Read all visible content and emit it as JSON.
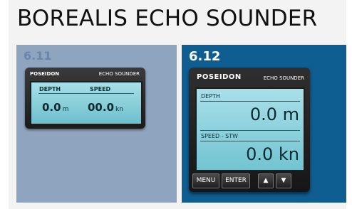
{
  "page": {
    "title": "BOREALIS ECHO SOUNDER"
  },
  "panels": [
    {
      "version": "6.11",
      "device": {
        "brand": "POSEIDON",
        "model": "ECHO SOUNDER",
        "depth_label": "DEPTH",
        "speed_label": "SPEED",
        "depth_value": "0.0",
        "depth_unit": "m",
        "speed_value": "00.0",
        "speed_unit": "kn"
      }
    },
    {
      "version": "6.12",
      "device": {
        "brand": "POSEIDON",
        "model": "ECHO SOUNDER",
        "depth_label": "DEPTH",
        "depth_value": "0.0 m",
        "speed_label": "SPEED - STW",
        "speed_value": "0.0 kn",
        "buttons": {
          "menu": "MENU",
          "enter": "ENTER",
          "up": "▲",
          "down": "▼"
        }
      }
    }
  ],
  "colors": {
    "panel_left_bg": "#8ea4bf",
    "panel_right_bg": "#0f5e91",
    "lcd": "#8fd3dd"
  }
}
